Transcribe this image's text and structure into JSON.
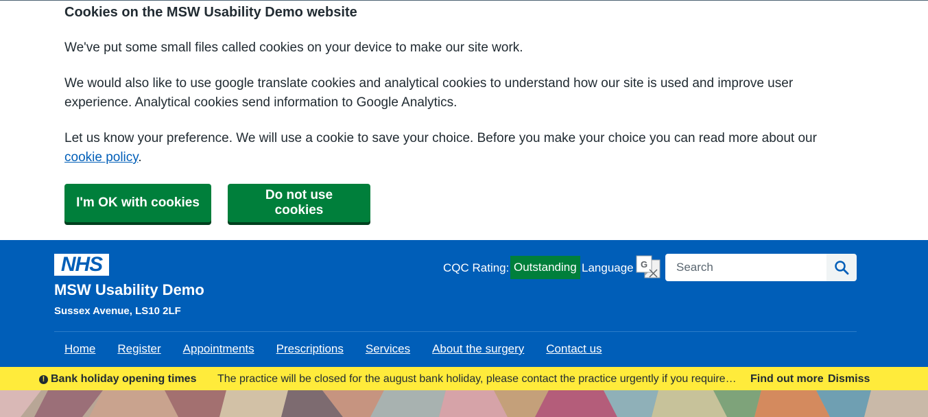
{
  "cookie_banner": {
    "title": "Cookies on the MSW Usability Demo website",
    "para1": "We've put some small files called cookies on your device to make our site work.",
    "para2": "We would also like to use google translate cookies and analytical cookies to understand how our site is used and improve user experience. Analytical cookies send information to Google Analytics.",
    "para3_text": "Let us know your preference. We will use a cookie to save your choice. Before you make your choice you can read more about our ",
    "para3_link": "cookie policy",
    "para3_end": ".",
    "accept_label": "I'm OK with cookies",
    "reject_label": "Do not use cookies"
  },
  "header": {
    "logo_text": "NHS",
    "site_name": "MSW Usability Demo",
    "address": "Sussex Avenue, LS10 2LF",
    "cqc_label": "CQC Rating:",
    "cqc_value": "Outstanding",
    "language_label": "Language",
    "search_placeholder": "Search"
  },
  "nav": {
    "items": [
      "Home",
      "Register",
      "Appointments",
      "Prescriptions",
      "Services",
      "About the surgery",
      "Contact us"
    ]
  },
  "notice": {
    "title": "Bank holiday opening times",
    "text": "The practice will be closed for the august bank holiday, please contact the practice urgently if you require a...",
    "more_label": "Find out more",
    "dismiss_label": "Dismiss"
  },
  "colors": {
    "nhs_blue": "#005eb8",
    "nhs_green": "#007f3b",
    "notice_yellow": "#ffeb3b"
  }
}
